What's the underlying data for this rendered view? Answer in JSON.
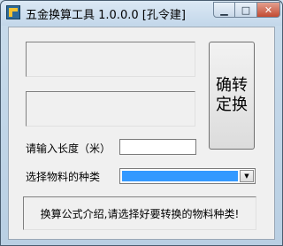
{
  "window": {
    "title": "五金换算工具 1.0.0.0 [孔令建]",
    "icon": "app-icon",
    "minimize_glyph": "▁",
    "maximize_glyph": "□",
    "close_glyph": "✕"
  },
  "output": {
    "box1_text": "",
    "box2_text": ""
  },
  "confirm_button": {
    "label_line1": "确转",
    "label_line2": "定换"
  },
  "length": {
    "label": "请输入长度（米）",
    "value": ""
  },
  "material": {
    "label": "选择物料的种类",
    "selected": "",
    "arrow_glyph": "▼",
    "highlight_color": "#3399ff"
  },
  "info": {
    "text": "换算公式介绍,请选择好要转换的物料种类!"
  }
}
